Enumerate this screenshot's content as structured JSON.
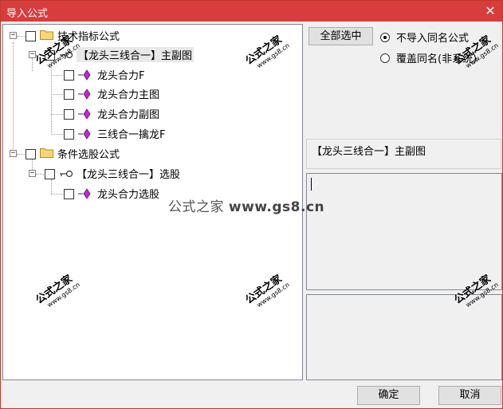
{
  "window": {
    "title": "导入公式",
    "close_label": "✕"
  },
  "tree": {
    "nodes": [
      {
        "label": "技术指标公式"
      },
      {
        "label": "【龙头三线合一】主副图"
      },
      {
        "label": "龙头合力F"
      },
      {
        "label": "龙头合力主图"
      },
      {
        "label": "龙头合力副图"
      },
      {
        "label": "三线合一擒龙F"
      },
      {
        "label": "条件选股公式"
      },
      {
        "label": "【龙头三线合一】选股"
      },
      {
        "label": "龙头合力选股"
      }
    ],
    "expander_minus": "−"
  },
  "right": {
    "select_all_label": "全部选中",
    "radio_skip_label": "不导入同名公式",
    "radio_overwrite_label": "覆盖同名(非系统)",
    "selected_name": "【龙头三线合一】主副图"
  },
  "buttons": {
    "ok_label": "确定",
    "cancel_label": "取消"
  },
  "watermark": {
    "brand": "公式之家",
    "url": "www.gs8.cn",
    "center_prefix": "公式之家",
    "center_url": "www.gs8.cn"
  },
  "colors": {
    "titlebar": "#d83c3c",
    "gem": "#c026d3"
  }
}
